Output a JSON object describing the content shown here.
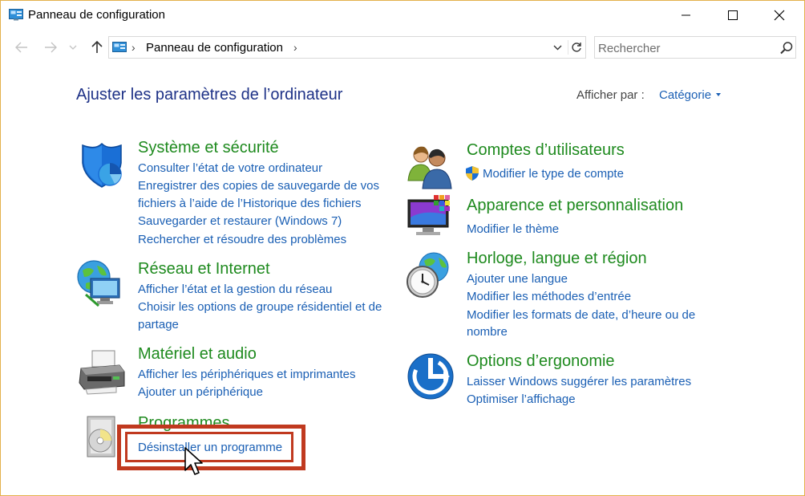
{
  "window": {
    "title": "Panneau de configuration",
    "border_color": "#e3b14b"
  },
  "navigation": {
    "address_path": "Panneau de configuration",
    "search_placeholder": "Rechercher"
  },
  "header": {
    "title": "Ajuster les paramètres de l’ordinateur",
    "view_by_label": "Afficher par :",
    "view_by_value": "Catégorie"
  },
  "categories": [
    {
      "id": "system-security",
      "icon": "shield-icon",
      "title": "Système et sécurité",
      "links": [
        "Consulter l’état de votre ordinateur",
        "Enregistrer des copies de sauvegarde de vos",
        "fichiers à l’aide de l’Historique des fichiers",
        "Sauvegarder et restaurer (Windows 7)",
        "Rechercher et résoudre des problèmes"
      ]
    },
    {
      "id": "network-internet",
      "icon": "network-globe-icon",
      "title": "Réseau et Internet",
      "links": [
        "Afficher l’état et la gestion du réseau",
        "Choisir les options de groupe résidentiel et de",
        "partage"
      ]
    },
    {
      "id": "hardware-sound",
      "icon": "printer-icon",
      "title": "Matériel et audio",
      "links": [
        "Afficher les périphériques et imprimantes",
        "Ajouter un périphérique"
      ]
    },
    {
      "id": "programs",
      "icon": "programs-disc-icon",
      "title": "Programmes",
      "links": [
        "Désinstaller un programme"
      ]
    },
    {
      "id": "user-accounts",
      "icon": "users-icon",
      "title": "Comptes d’utilisateurs",
      "links": [
        "Modifier le type de compte"
      ]
    },
    {
      "id": "appearance",
      "icon": "monitor-palette-icon",
      "title": "Apparence et personnalisation",
      "links": [
        "Modifier le thème"
      ]
    },
    {
      "id": "clock-language",
      "icon": "clock-globe-icon",
      "title": "Horloge, langue et région",
      "links": [
        "Ajouter une langue",
        "Modifier les méthodes d’entrée",
        "Modifier les formats de date, d’heure ou de",
        "nombre"
      ]
    },
    {
      "id": "ease-of-access",
      "icon": "ease-of-access-icon",
      "title": "Options d’ergonomie",
      "links": [
        "Laisser Windows suggérer les paramètres",
        "Optimiser l’affichage"
      ]
    }
  ],
  "colors": {
    "title_blue": "#1e3287",
    "link_blue": "#1a5fb4",
    "category_green": "#1e8a1e",
    "highlight_red": "#c0391f"
  }
}
